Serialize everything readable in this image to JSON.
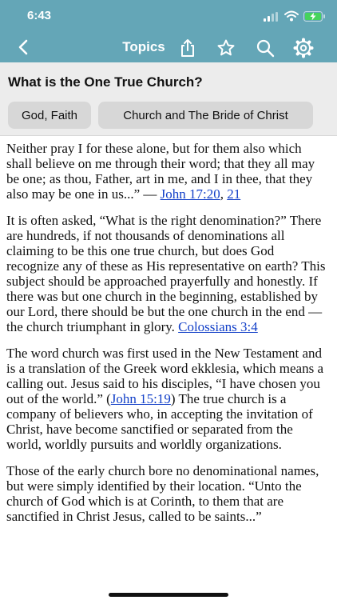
{
  "status": {
    "time": "6:43"
  },
  "nav": {
    "title": "Topics"
  },
  "page": {
    "title": "What is the One True Church?"
  },
  "chips": [
    {
      "label": "God, Faith"
    },
    {
      "label": "Church and The Bride of Christ"
    }
  ],
  "content": {
    "p1": {
      "text": "Neither pray I for these alone, but for them also which shall believe on me through their word; that they all may be one; as thou, Father, art in me, and I in thee, that they also may be one in us...” — ",
      "link1": "John 17:20",
      "sep": ", ",
      "link2": "21"
    },
    "p2": {
      "text": "It is often asked, “What is the right denomination?” There are hundreds, if not thousands of denominations all claiming to be this one true church, but does God recognize any of these as His representative on earth?  This subject should be approached prayerfully and honestly. If there was but one church in the beginning, established by our Lord, there should be but the one church in the end — the church triumphant in glory. ",
      "link": "Colossians 3:4"
    },
    "p3": {
      "text1": "The word church was first used in the New Testament and is a translation of the Greek word ekklesia, which means a calling out. Jesus said to his disciples, “I have chosen you  out of the world.” (",
      "link": "John 15:19",
      "text2": ")  The true church is a company of believers who, in accepting the invitation of Christ, have become sanctified or separated from the world, worldly pursuits and worldly organizations."
    },
    "p4": {
      "text": "Those of the early church bore no denominational names, but were simply identified by their location. “Unto the church of God which is at Corinth, to them that are sanctified in Christ Jesus, called to be saints...”"
    }
  }
}
